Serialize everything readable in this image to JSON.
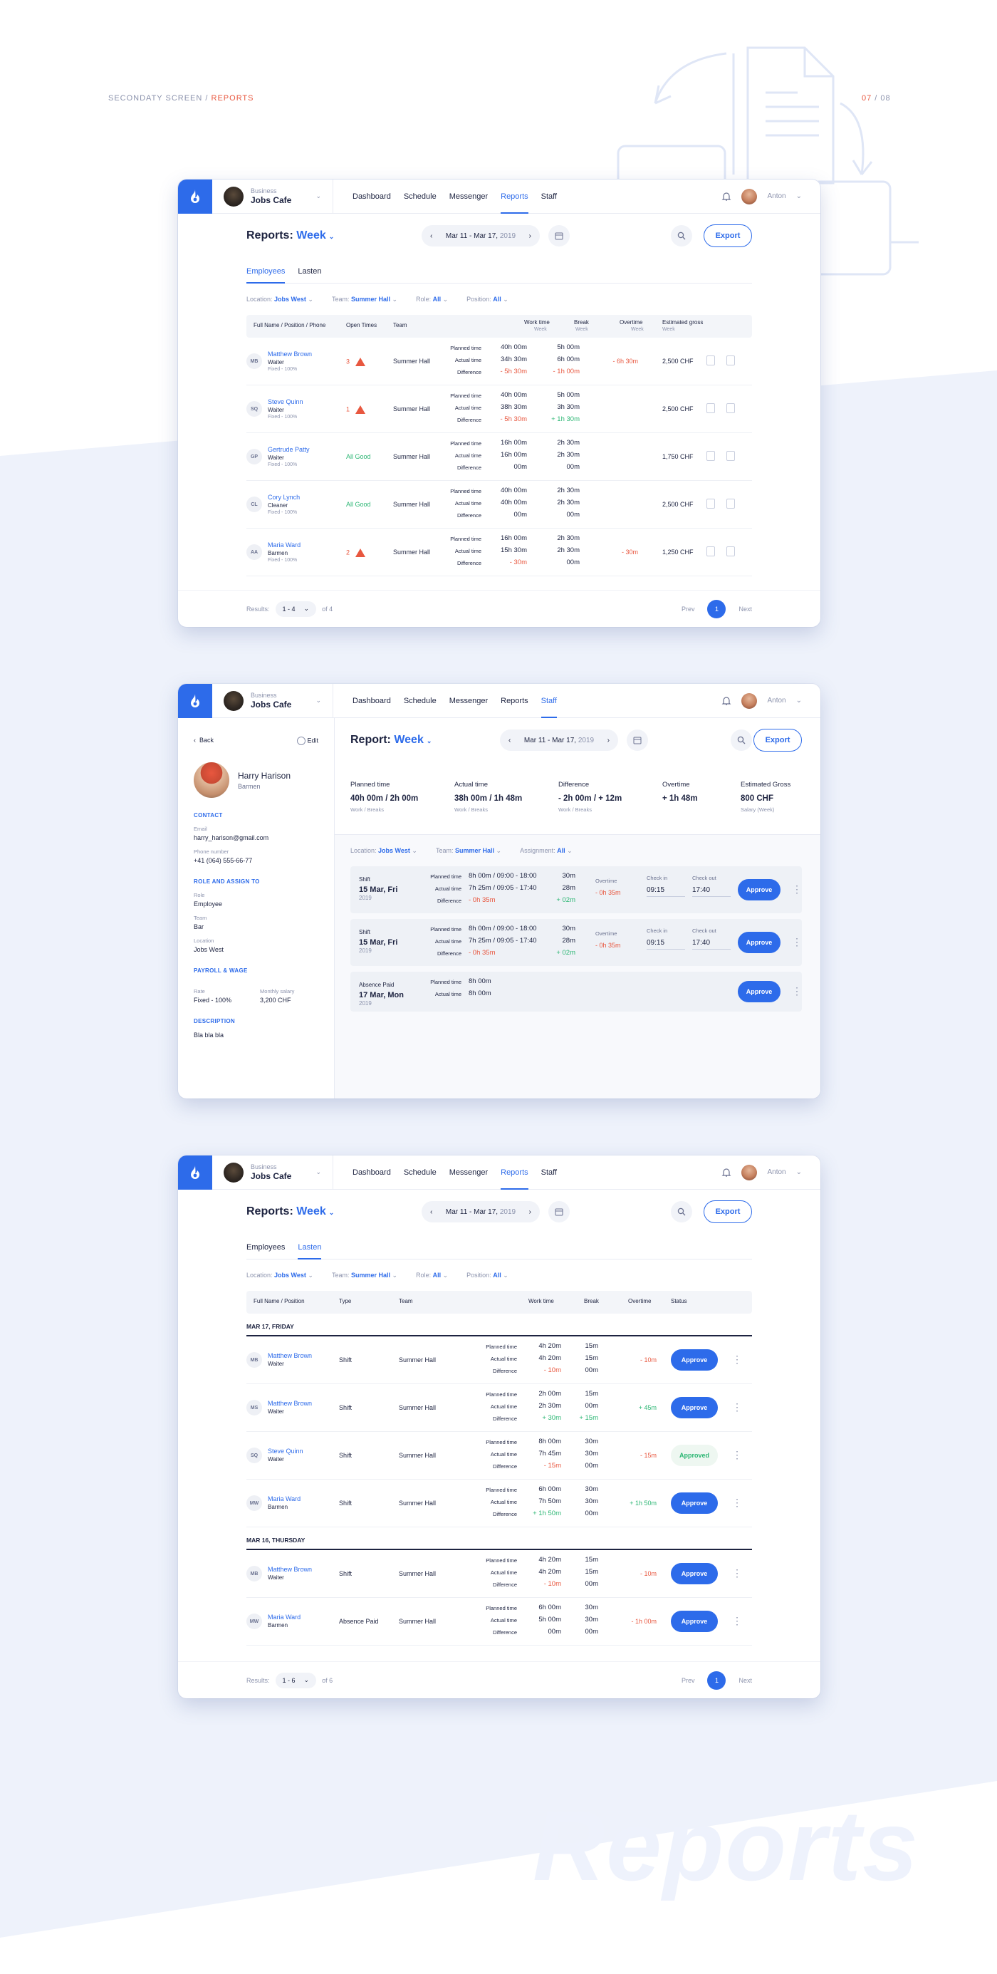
{
  "header": {
    "left": "SECONDATY SCREEN / ",
    "left_accent": "REPORTS",
    "page": "07",
    "total": " / 08"
  },
  "bigword": "Reports",
  "topbar": {
    "business_label": "Business",
    "business_name": "Jobs Cafe",
    "nav": [
      "Dashboard",
      "Schedule",
      "Messenger",
      "Reports",
      "Staff"
    ],
    "user": "Anton"
  },
  "screen1": {
    "title": "Reports:",
    "period": "Week",
    "date_range": "Mar 11 - Mar 17,",
    "year": "2019",
    "export": "Export",
    "tabs": [
      "Employees",
      "Lasten"
    ],
    "filters": [
      {
        "k": "Location:",
        "v": "Jobs West"
      },
      {
        "k": "Team:",
        "v": "Summer Hall"
      },
      {
        "k": "Role:",
        "v": "All"
      },
      {
        "k": "Position:",
        "v": "All"
      }
    ],
    "columns": {
      "name": "Full Name / Position / Phone",
      "open": "Open Times",
      "team": "Team",
      "work": "Work time",
      "break": "Break",
      "overtime": "Overtime",
      "gross": "Estimated gross",
      "week": "Week"
    },
    "row_labels": [
      "Planned time",
      "Actual time",
      "Difference"
    ],
    "rows": [
      {
        "initials": "MB",
        "name": "Matthew Brown",
        "position": "Waiter",
        "rate": "Fixed - 100%",
        "open": "3",
        "team": "Summer Hall",
        "work": [
          "40h 00m",
          "34h 30m",
          "- 5h 30m"
        ],
        "brk": [
          "5h 00m",
          "6h 00m",
          "- 1h 00m"
        ],
        "overtime": "- 6h 30m",
        "gross": "2,500 CHF"
      },
      {
        "initials": "SQ",
        "name": "Steve Quinn",
        "position": "Waiter",
        "rate": "Fixed - 100%",
        "open": "1",
        "team": "Summer Hall",
        "work": [
          "40h 00m",
          "38h 30m",
          "- 5h 30m"
        ],
        "brk": [
          "5h 00m",
          "3h 30m",
          "+ 1h 30m"
        ],
        "overtime": "",
        "gross": "2,500 CHF"
      },
      {
        "initials": "GP",
        "name": "Gertrude Patty",
        "position": "Waiter",
        "rate": "Fixed - 100%",
        "open": "All Good",
        "team": "Summer Hall",
        "work": [
          "16h 00m",
          "16h 00m",
          "00m"
        ],
        "brk": [
          "2h 30m",
          "2h 30m",
          "00m"
        ],
        "overtime": "",
        "gross": "1,750 CHF"
      },
      {
        "initials": "CL",
        "name": "Cory Lynch",
        "position": "Cleaner",
        "rate": "Fixed - 100%",
        "open": "All Good",
        "team": "Summer Hall",
        "work": [
          "40h 00m",
          "40h 00m",
          "00m"
        ],
        "brk": [
          "2h 30m",
          "2h 30m",
          "00m"
        ],
        "overtime": "",
        "gross": "2,500 CHF"
      },
      {
        "initials": "AA",
        "name": "Maria Ward",
        "position": "Barmen",
        "rate": "Fixed - 100%",
        "open": "2",
        "team": "Summer Hall",
        "work": [
          "16h 00m",
          "15h 30m",
          "- 30m"
        ],
        "brk": [
          "2h 30m",
          "2h 30m",
          "00m"
        ],
        "overtime": "- 30m",
        "gross": "1,250 CHF"
      }
    ],
    "footer": {
      "results": "Results:",
      "range": "1 - 4",
      "of": "of 4",
      "prev": "Prev",
      "page": "1",
      "next": "Next"
    }
  },
  "screen2": {
    "back": "Back",
    "edit": "Edit",
    "name": "Harry Harison",
    "role": "Barmen",
    "contact_h": "CONTACT",
    "email_l": "Email",
    "email": "harry_harison@gmail.com",
    "phone_l": "Phone number",
    "phone": "+41 (064) 555-66-77",
    "role_h": "ROLE AND ASSIGN TO",
    "role_l": "Role",
    "role_v": "Employee",
    "team_l": "Team",
    "team_v": "Bar",
    "loc_l": "Location",
    "loc_v": "Jobs West",
    "pay_h": "PAYROLL & WAGE",
    "rate_l": "Rate",
    "rate_v": "Fixed - 100%",
    "sal_l": "Monthly salary",
    "sal_v": "3,200 CHF",
    "desc_h": "DESCRIPTION",
    "desc": "Bla bla bla",
    "title": "Report:",
    "period": "Week",
    "date_range": "Mar 11 - Mar 17,",
    "year": "2019",
    "export": "Export",
    "stats": [
      {
        "a": "Planned time",
        "b": "40h 00m / 2h 00m",
        "c": "Work / Breaks"
      },
      {
        "a": "Actual time",
        "b": "38h 00m / 1h 48m",
        "c": "Work / Breaks"
      },
      {
        "a": "Difference",
        "b": "- 2h 00m / + 12m",
        "c": "Work / Breaks"
      },
      {
        "a": "Overtime",
        "b": "+ 1h 48m",
        "c": ""
      },
      {
        "a": "Estimated Gross",
        "b": "800 CHF",
        "c": "Salary (Week)"
      }
    ],
    "filters": [
      {
        "k": "Location:",
        "v": "Jobs West"
      },
      {
        "k": "Team:",
        "v": "Summer Hall"
      },
      {
        "k": "Assignment:",
        "v": "All"
      }
    ],
    "labels": [
      "Planned time",
      "Actual time",
      "Difference"
    ],
    "ot_label": "Overtime",
    "ci_label": "Check in",
    "co_label": "Check out",
    "approve": "Approve",
    "cards": [
      {
        "type": "Shift",
        "date": "15 Mar, Fri",
        "year": "2019",
        "p": "8h 00m / 09:00 - 18:00",
        "a": "7h 25m / 09:05 - 17:40",
        "d": "- 0h 35m",
        "bp": "30m",
        "ba": "28m",
        "bd": "+ 02m",
        "ot": "- 0h 35m",
        "ci": "09:15",
        "co": "17:40"
      },
      {
        "type": "Shift",
        "date": "15 Mar, Fri",
        "year": "2019",
        "p": "8h 00m / 09:00 - 18:00",
        "a": "7h 25m / 09:05 - 17:40",
        "d": "- 0h 35m",
        "bp": "30m",
        "ba": "28m",
        "bd": "+ 02m",
        "ot": "- 0h 35m",
        "ci": "09:15",
        "co": "17:40"
      },
      {
        "type": "Absence Paid",
        "date": "17 Mar, Mon",
        "year": "2019",
        "p": "8h 00m",
        "a": "8h 00m"
      }
    ]
  },
  "screen3": {
    "title": "Reports:",
    "period": "Week",
    "date_range": "Mar 11 - Mar 17,",
    "year": "2019",
    "export": "Export",
    "tabs": [
      "Employees",
      "Lasten"
    ],
    "filters": [
      {
        "k": "Location:",
        "v": "Jobs West"
      },
      {
        "k": "Team:",
        "v": "Summer Hall"
      },
      {
        "k": "Role:",
        "v": "All"
      },
      {
        "k": "Position:",
        "v": "All"
      }
    ],
    "columns": {
      "name": "Full Name / Position",
      "type": "Type",
      "team": "Team",
      "work": "Work time",
      "break": "Break",
      "overtime": "Overtime",
      "status": "Status"
    },
    "labels": [
      "Planned time",
      "Actual time",
      "Difference"
    ],
    "groups": [
      {
        "title": "MAR 17, FRIDAY",
        "rows": [
          {
            "initials": "MB",
            "name": "Matthew Brown",
            "position": "Waiter",
            "type": "Shift",
            "team": "Summer Hall",
            "work": [
              "4h 20m",
              "4h 20m",
              "- 10m"
            ],
            "brk": [
              "15m",
              "15m",
              "00m"
            ],
            "overtime": "- 10m",
            "status": "Approve"
          },
          {
            "initials": "MS",
            "name": "Matthew Brown",
            "position": "Waiter",
            "type": "Shift",
            "team": "Summer Hall",
            "work": [
              "2h 00m",
              "2h 30m",
              "+ 30m"
            ],
            "brk": [
              "15m",
              "00m",
              "+ 15m"
            ],
            "overtime": "+ 45m",
            "status": "Approve"
          },
          {
            "initials": "SQ",
            "name": "Steve Quinn",
            "position": "Waiter",
            "type": "Shift",
            "team": "Summer Hall",
            "work": [
              "8h 00m",
              "7h 45m",
              "- 15m"
            ],
            "brk": [
              "30m",
              "30m",
              "00m"
            ],
            "overtime": "- 15m",
            "status": "Approved"
          },
          {
            "initials": "MW",
            "name": "Maria Ward",
            "position": "Barmen",
            "type": "Shift",
            "team": "Summer Hall",
            "work": [
              "6h 00m",
              "7h 50m",
              "+ 1h 50m"
            ],
            "brk": [
              "30m",
              "30m",
              "00m"
            ],
            "overtime": "+ 1h 50m",
            "status": "Approve"
          }
        ]
      },
      {
        "title": "MAR 16, THURSDAY",
        "rows": [
          {
            "initials": "MB",
            "name": "Matthew Brown",
            "position": "Waiter",
            "type": "Shift",
            "team": "Summer Hall",
            "work": [
              "4h 20m",
              "4h 20m",
              "- 10m"
            ],
            "brk": [
              "15m",
              "15m",
              "00m"
            ],
            "overtime": "- 10m",
            "status": "Approve"
          },
          {
            "initials": "MW",
            "name": "Maria Ward",
            "position": "Barmen",
            "type": "Absence Paid",
            "team": "Summer Hall",
            "work": [
              "6h 00m",
              "5h 00m",
              "00m"
            ],
            "brk": [
              "30m",
              "30m",
              "00m"
            ],
            "overtime": "- 1h 00m",
            "status": "Approve"
          }
        ]
      }
    ],
    "footer": {
      "results": "Results:",
      "range": "1 - 6",
      "of": "of 6",
      "prev": "Prev",
      "page": "1",
      "next": "Next"
    }
  }
}
